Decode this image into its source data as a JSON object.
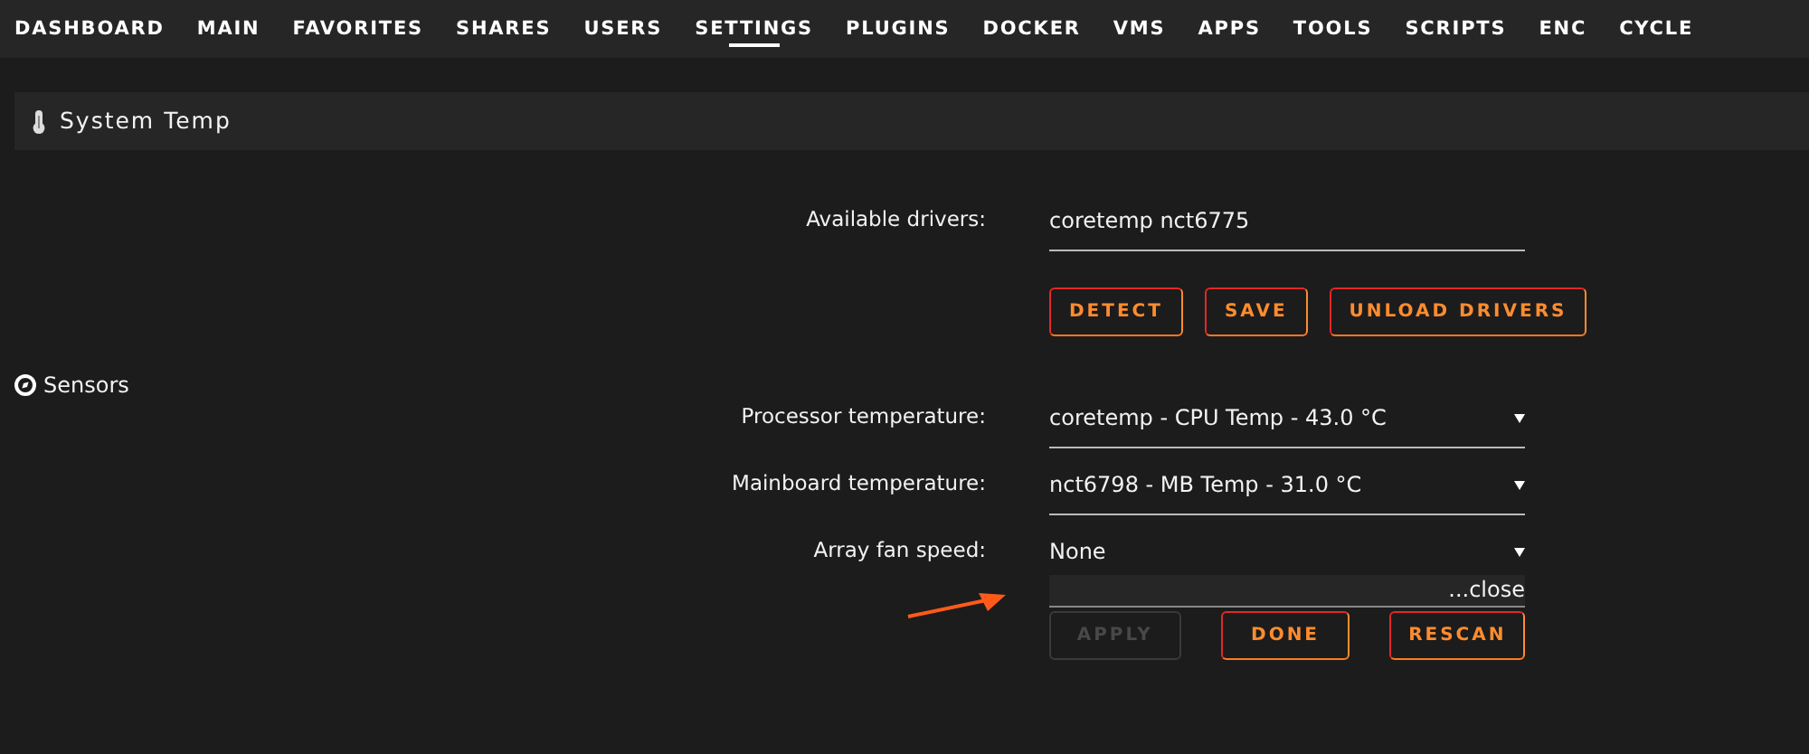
{
  "nav": [
    {
      "label": "DASHBOARD",
      "selected": false
    },
    {
      "label": "MAIN",
      "selected": false
    },
    {
      "label": "FAVORITES",
      "selected": false
    },
    {
      "label": "SHARES",
      "selected": false
    },
    {
      "label": "USERS",
      "selected": false
    },
    {
      "label": "SETTINGS",
      "selected": true
    },
    {
      "label": "PLUGINS",
      "selected": false
    },
    {
      "label": "DOCKER",
      "selected": false
    },
    {
      "label": "VMS",
      "selected": false
    },
    {
      "label": "APPS",
      "selected": false
    },
    {
      "label": "TOOLS",
      "selected": false
    },
    {
      "label": "SCRIPTS",
      "selected": false
    },
    {
      "label": "ENC",
      "selected": false
    },
    {
      "label": "CYCLE",
      "selected": false
    }
  ],
  "section_title": "System Temp",
  "drivers": {
    "label": "Available drivers:",
    "value": "coretemp nct6775"
  },
  "driver_buttons": [
    {
      "label": "DETECT",
      "disabled": false
    },
    {
      "label": "SAVE",
      "disabled": false
    },
    {
      "label": "UNLOAD DRIVERS",
      "disabled": false
    }
  ],
  "sensors_heading": "Sensors",
  "sensors": [
    {
      "label": "Processor temperature:",
      "value": "coretemp - CPU Temp - 43.0 °C"
    },
    {
      "label": "Mainboard temperature:",
      "value": "nct6798 - MB Temp - 31.0 °C"
    },
    {
      "label": "Array fan speed:",
      "value": "None"
    }
  ],
  "dropdown_close": "...close",
  "sensor_buttons": [
    {
      "label": "APPLY",
      "disabled": true
    },
    {
      "label": "DONE",
      "disabled": false
    },
    {
      "label": "RESCAN",
      "disabled": false
    }
  ]
}
